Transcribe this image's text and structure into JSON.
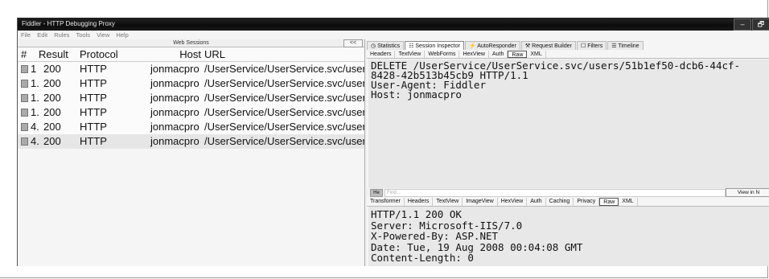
{
  "window": {
    "title": "Fiddler - HTTP Debugging Proxy",
    "controls": [
      "–",
      "🗗"
    ]
  },
  "menu": [
    "File",
    "Edit",
    "Rules",
    "Tools",
    "View",
    "Help"
  ],
  "web_sessions": {
    "title": "Web Sessions",
    "collapse_label": "<<",
    "columns": [
      "#",
      "Result",
      "Protocol",
      "Host",
      "URL"
    ],
    "rows": [
      {
        "num": "1",
        "result": "200",
        "protocol": "HTTP",
        "host": "jonmacpro",
        "url": "/UserService/UserService.svc/users"
      },
      {
        "num": "1.",
        "result": "200",
        "protocol": "HTTP",
        "host": "jonmacpro",
        "url": "/UserService/UserService.svc/users"
      },
      {
        "num": "1.",
        "result": "200",
        "protocol": "HTTP",
        "host": "jonmacpro",
        "url": "/UserService/UserService.svc/users"
      },
      {
        "num": "1.",
        "result": "200",
        "protocol": "HTTP",
        "host": "jonmacpro",
        "url": "/UserService/UserService.svc/users"
      },
      {
        "num": "4.",
        "result": "200",
        "protocol": "HTTP",
        "host": "jonmacpro",
        "url": "/UserService/UserService.svc/users/"
      },
      {
        "num": "4.",
        "result": "200",
        "protocol": "HTTP",
        "host": "jonmacpro",
        "url": "/UserService/UserService.svc/users/"
      }
    ]
  },
  "tabs": [
    "Statistics",
    "Session Inspector",
    "AutoResponder",
    "Request Builder",
    "Filters",
    "Timeline"
  ],
  "request_subtabs": [
    "Headers",
    "TextView",
    "WebForms",
    "HexView",
    "Auth",
    "Raw",
    "XML"
  ],
  "request_text": "DELETE /UserService/UserService.svc/users/51b1ef50-dcb6-44cf-\n8428-42b513b45cb9 HTTP/1.1\nUser-Agent: Fiddler\nHost: jonmacpro",
  "find_bar": {
    "hex_label": "He",
    "placeholder": "Find...",
    "view_button": "View in N"
  },
  "response_subtabs": [
    "Transformer",
    "Headers",
    "TextView",
    "ImageView",
    "HexView",
    "Auth",
    "Caching",
    "Privacy",
    "Raw",
    "XML"
  ],
  "response_text": "HTTP/1.1 200 OK\nServer: Microsoft-IIS/7.0\nX-Powered-By: ASP.NET\nDate: Tue, 19 Aug 2008 00:04:08 GMT\nContent-Length: 0"
}
